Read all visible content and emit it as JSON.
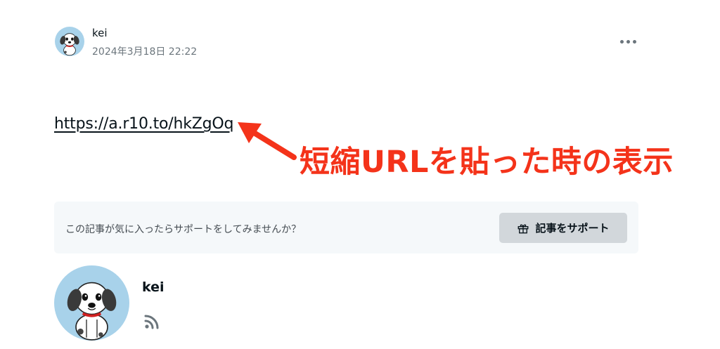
{
  "header": {
    "author_name": "kei",
    "post_date": "2024年3月18日 22:22",
    "more_icon": "ellipsis-icon"
  },
  "content": {
    "link_text": "https://a.r10.to/hkZgOq",
    "annotation": "短縮URLを貼った時の表示",
    "annotation_color": "#f4331a"
  },
  "support": {
    "prompt": "この記事が気に入ったらサポートをしてみませんか？",
    "button_label": "記事をサポート",
    "button_icon": "gift-icon"
  },
  "profile": {
    "name": "kei",
    "rss_icon": "rss-icon"
  },
  "colors": {
    "text": "#08131a",
    "muted": "#6b757c",
    "avatar_bg": "#a8d2ea",
    "support_bg": "#f5f8fa",
    "button_bg": "#d2d7db"
  }
}
